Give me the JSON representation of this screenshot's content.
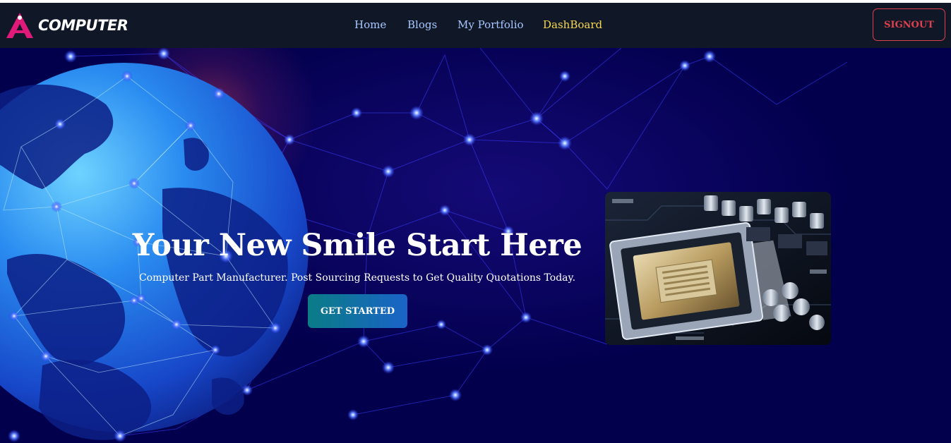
{
  "header": {
    "brand_name": "COMPUTER",
    "logo_icon": "triangle-a-logo-icon",
    "nav": [
      {
        "label": "Home",
        "active": false
      },
      {
        "label": "Blogs",
        "active": false
      },
      {
        "label": "My Portfolio",
        "active": false
      },
      {
        "label": "DashBoard",
        "active": true
      }
    ],
    "signout_label": "SIGNOUT"
  },
  "hero": {
    "title": "Your New Smile Start Here",
    "subtitle": "Computer Part Manufacturer. Post Sourcing Requests to Get Quality Quotations Today.",
    "cta_label": "GET STARTED",
    "image": "computer-motherboard-cpu-socket-photo",
    "background": "globe-network-background"
  },
  "colors": {
    "navbar_bg": "#101828",
    "nav_link": "#a9c8ff",
    "nav_active": "#f7d84c",
    "signout": "#e0404c",
    "hero_bg": "#02004d",
    "cta_start": "#0a7c86",
    "cta_end": "#1a63c8"
  }
}
